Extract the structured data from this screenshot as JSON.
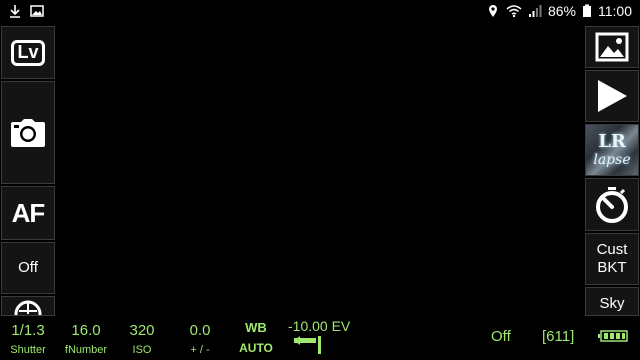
{
  "status_bar": {
    "left_icons": [
      "download-icon",
      "image-icon"
    ],
    "right_icons": [
      "location-icon",
      "wifi-icon",
      "signal-icon"
    ],
    "battery": "86%",
    "time": "11:00"
  },
  "left_buttons": {
    "liveview": {
      "label": "Lv",
      "icon": "liveview-icon"
    },
    "capture": {
      "icon": "camera-icon"
    },
    "af": {
      "label": "AF"
    },
    "off": {
      "label": "Off"
    }
  },
  "right_buttons": {
    "gallery": {
      "icon": "gallery-icon"
    },
    "play": {
      "icon": "play-icon"
    },
    "timelapse": {
      "label_top": "LR",
      "label_bottom": "lapse",
      "icon": "timelapse-thumbnail"
    },
    "timer": {
      "icon": "timer-icon"
    },
    "custom_bkt": {
      "line1": "Cust",
      "line2": "BKT"
    },
    "sky": {
      "label": "Sky"
    }
  },
  "bottom_bar": {
    "color": "#9fe870",
    "shutter": {
      "value": "1/1.3",
      "label": "Shutter"
    },
    "fnumber": {
      "value": "16.0",
      "label": "fNumber"
    },
    "iso": {
      "value": "320",
      "label": "ISO"
    },
    "exposure": {
      "value": "0.0",
      "label": "+ / -"
    },
    "wb": {
      "label": "WB",
      "value": "AUTO"
    },
    "ev": {
      "value": "-10.00 EV"
    },
    "mode": {
      "value": "Off"
    },
    "shots": {
      "value": "[611]"
    },
    "battery_icon": "battery-icon"
  }
}
